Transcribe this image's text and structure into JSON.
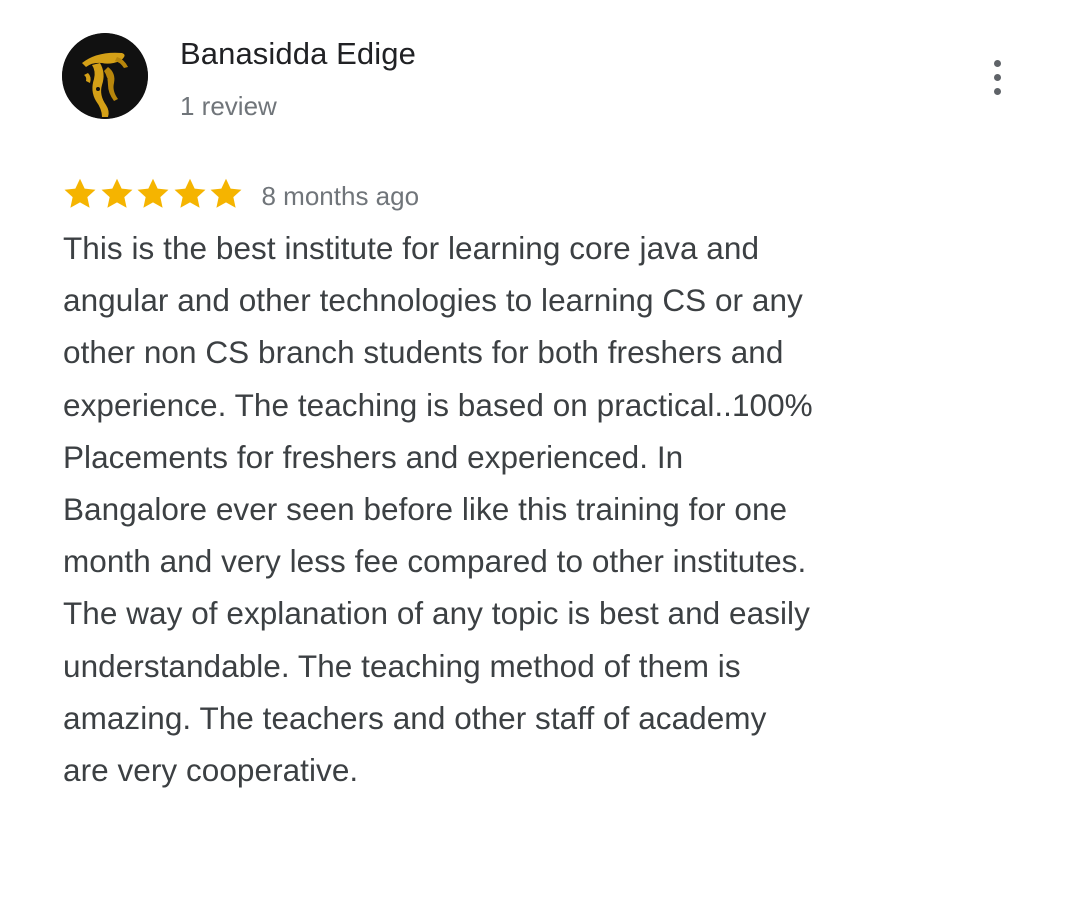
{
  "reviewer": {
    "name": "Banasidda Edige",
    "review_count": "1 review"
  },
  "review": {
    "rating": 5,
    "rating_max": 5,
    "time_ago": "8 months ago",
    "text": "This is the best institute for learning core java and\nangular and other technologies to learning CS or any\nother non CS branch students for both freshers and\nexperience. The teaching is based on practical..100%\nPlacements for freshers and experienced. In\nBangalore  ever seen before  like this training for one\nmonth and very less fee compared to other institutes.\nThe way of explanation of any topic is best and easily\nunderstandable.  The teaching method of them is\namazing. The teachers and other staff of academy\nare very cooperative."
  },
  "icons": {
    "avatar": "avatar-image",
    "star": "star-icon",
    "more": "more-vert-icon"
  },
  "colors": {
    "star": "#f5b400",
    "name": "#202124",
    "secondary": "#70757a",
    "body_text": "#3c4043",
    "avatar_bg": "#111111",
    "avatar_fg": "#d4a017"
  }
}
